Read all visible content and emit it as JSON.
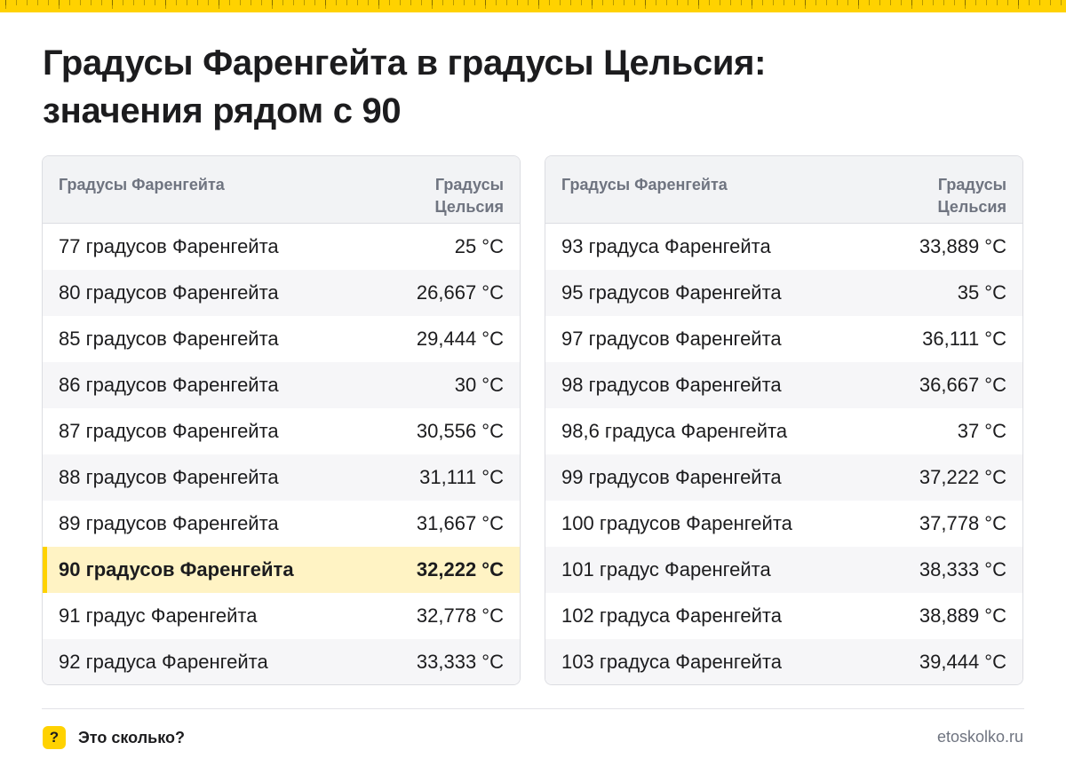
{
  "title": {
    "line1": "Градусы Фаренгейта в градусы Цельсия:",
    "line2": "значения рядом с 90"
  },
  "tables": [
    {
      "header": {
        "fahrenheit": "Градусы Фаренгейта",
        "celsius_line1": "Градусы",
        "celsius_line2": "Цельсия"
      },
      "rows": [
        {
          "f": "77 градусов Фаренгейта",
          "c": "25 °C"
        },
        {
          "f": "80 градусов Фаренгейта",
          "c": "26,667 °C"
        },
        {
          "f": "85 градусов Фаренгейта",
          "c": "29,444 °C"
        },
        {
          "f": "86 градусов Фаренгейта",
          "c": "30 °C"
        },
        {
          "f": "87 градусов Фаренгейта",
          "c": "30,556 °C"
        },
        {
          "f": "88 градусов Фаренгейта",
          "c": "31,111 °C"
        },
        {
          "f": "89 градусов Фаренгейта",
          "c": "31,667 °C"
        },
        {
          "f": "90 градусов Фаренгейта",
          "c": "32,222 °C"
        },
        {
          "f": "91 градус Фаренгейта",
          "c": "32,778 °C"
        },
        {
          "f": "92 градуса Фаренгейта",
          "c": "33,333 °C"
        }
      ]
    },
    {
      "header": {
        "fahrenheit": "Градусы Фаренгейта",
        "celsius_line1": "Градусы",
        "celsius_line2": "Цельсия"
      },
      "rows": [
        {
          "f": "93 градуса Фаренгейта",
          "c": "33,889 °C"
        },
        {
          "f": "95 градусов Фаренгейта",
          "c": "35 °C"
        },
        {
          "f": "97 градусов Фаренгейта",
          "c": "36,111 °C"
        },
        {
          "f": "98 градусов Фаренгейта",
          "c": "36,667 °C"
        },
        {
          "f": "98,6 градуса Фаренгейта",
          "c": "37 °C"
        },
        {
          "f": "99 градусов Фаренгейта",
          "c": "37,222 °C"
        },
        {
          "f": "100 градусов Фаренгейта",
          "c": "37,778 °C"
        },
        {
          "f": "101 градус Фаренгейта",
          "c": "38,333 °C"
        },
        {
          "f": "102 градуса Фаренгейта",
          "c": "38,889 °C"
        },
        {
          "f": "103 градуса Фаренгейта",
          "c": "39,444 °C"
        }
      ]
    }
  ],
  "footer": {
    "brand_icon": "?",
    "brand_name": "Это сколько?",
    "site": "etoskolko.ru"
  },
  "colors": {
    "accent": "#ffd200",
    "highlight_row": "#fff3c4",
    "header_bg": "#f2f3f5",
    "muted_text": "#6f7480"
  }
}
